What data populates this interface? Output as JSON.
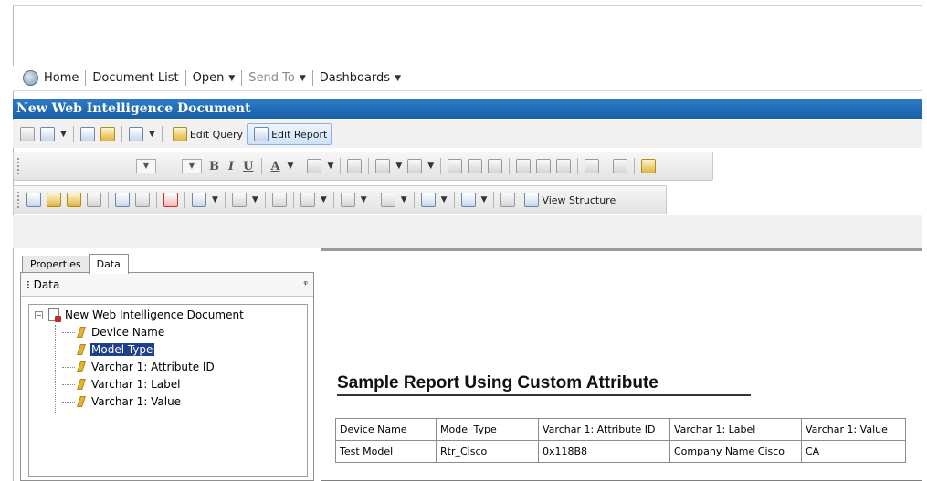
{
  "nav": {
    "home": "Home",
    "document_list": "Document List",
    "open": "Open",
    "send_to": "Send To",
    "dashboards": "Dashboards"
  },
  "window": {
    "title": "New Web Intelligence Document"
  },
  "toolbar": {
    "edit_query": "Edit Query",
    "edit_report": "Edit Report",
    "view_structure": "View Structure"
  },
  "left_panel": {
    "tabs": [
      "Properties",
      "Data"
    ],
    "active_tab": "Data",
    "header": "Data",
    "tree": {
      "root": "New Web Intelligence Document",
      "items": [
        "Device Name",
        "Model Type",
        "Varchar 1: Attribute ID",
        "Varchar 1: Label",
        "Varchar 1: Value"
      ],
      "selected": "Model Type"
    }
  },
  "report": {
    "title": "Sample Report Using Custom Attribute",
    "columns": [
      "Device Name",
      "Model Type",
      "Varchar 1: Attribute ID",
      "Varchar 1: Label",
      "Varchar 1: Value"
    ],
    "rows": [
      [
        "Test Model",
        "Rtr_Cisco",
        "0x118B8",
        "Company Name Cisco",
        "CA"
      ]
    ]
  },
  "colors": {
    "title_bar": "#195fa6",
    "selection": "#1e3f8c"
  }
}
